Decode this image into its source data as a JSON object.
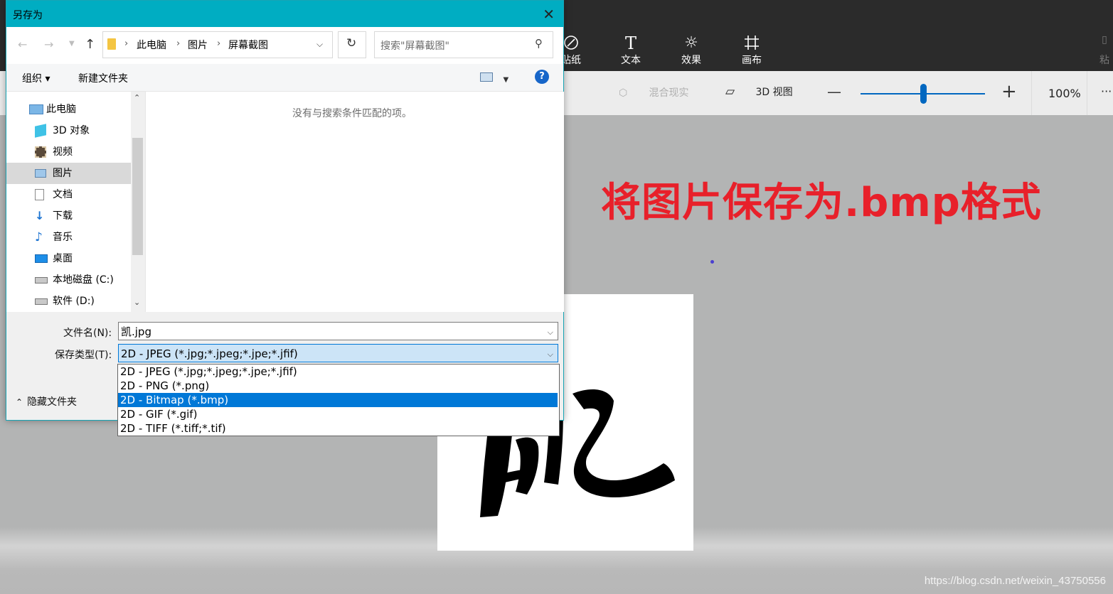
{
  "paint3d": {
    "tools": [
      {
        "icon": "sticker-icon",
        "label": "贴纸"
      },
      {
        "icon": "text-icon",
        "label": "文本"
      },
      {
        "icon": "effects-icon",
        "label": "效果"
      },
      {
        "icon": "canvas-icon",
        "label": "画布"
      }
    ],
    "paste_label": "粘",
    "mixed_reality_label": "混合现实",
    "view3d_label": "3D 视图",
    "zoom_percent": "100%",
    "zoom_level": 0.5,
    "more_label": "···"
  },
  "annotation": {
    "text": "将图片保存为.bmp格式"
  },
  "watermark": "https://blog.csdn.net/weixin_43750556",
  "dialog": {
    "title": "另存为",
    "breadcrumb": [
      "此电脑",
      "图片",
      "屏幕截图"
    ],
    "search_placeholder": "搜索\"屏幕截图\"",
    "organize_label": "组织 ▾",
    "new_folder_label": "新建文件夹",
    "help_label": "?",
    "empty_message": "没有与搜索条件匹配的项。",
    "nav_items": [
      {
        "icon": "computer-icon",
        "label": "此电脑"
      },
      {
        "icon": "3d-objects-icon",
        "label": "3D 对象"
      },
      {
        "icon": "video-icon",
        "label": "视频"
      },
      {
        "icon": "pictures-icon",
        "label": "图片"
      },
      {
        "icon": "documents-icon",
        "label": "文档"
      },
      {
        "icon": "downloads-icon",
        "label": "下载"
      },
      {
        "icon": "music-icon",
        "label": "音乐"
      },
      {
        "icon": "desktop-icon",
        "label": "桌面"
      },
      {
        "icon": "drive-c-icon",
        "label": "本地磁盘 (C:)"
      },
      {
        "icon": "drive-d-icon",
        "label": "软件 (D:)"
      }
    ],
    "filename_label": "文件名(N):",
    "filename_value": "凯.jpg",
    "filetype_label": "保存类型(T):",
    "filetype_value": "2D - JPEG (*.jpg;*.jpeg;*.jpe;*.jfif)",
    "filetype_options": [
      "2D - JPEG (*.jpg;*.jpeg;*.jpe;*.jfif)",
      "2D - PNG (*.png)",
      "2D - Bitmap (*.bmp)",
      "2D - GIF (*.gif)",
      "2D - TIFF (*.tiff;*.tif)"
    ],
    "highlighted_option": 2,
    "hide_folders_label": "隐藏文件夹"
  }
}
